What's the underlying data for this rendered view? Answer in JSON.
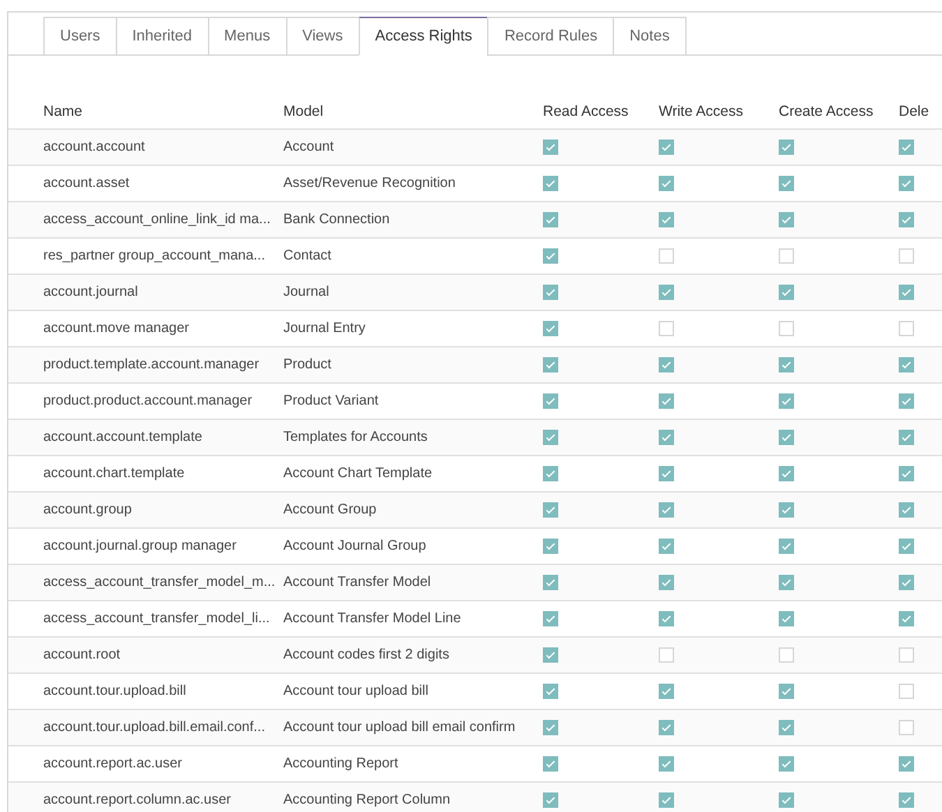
{
  "tabs": [
    {
      "label": "Users",
      "selected": false
    },
    {
      "label": "Inherited",
      "selected": false
    },
    {
      "label": "Menus",
      "selected": false
    },
    {
      "label": "Views",
      "selected": false
    },
    {
      "label": "Access Rights",
      "selected": true
    },
    {
      "label": "Record Rules",
      "selected": false
    },
    {
      "label": "Notes",
      "selected": false
    }
  ],
  "table": {
    "columns": [
      "Name",
      "Model",
      "Read Access",
      "Write Access",
      "Create Access",
      "Dele"
    ],
    "rows": [
      {
        "name": "account.account",
        "model": "Account",
        "read": true,
        "write": true,
        "create": true,
        "delete": true
      },
      {
        "name": "account.asset",
        "model": "Asset/Revenue Recognition",
        "read": true,
        "write": true,
        "create": true,
        "delete": true
      },
      {
        "name": "access_account_online_link_id ma...",
        "model": "Bank Connection",
        "read": true,
        "write": true,
        "create": true,
        "delete": true
      },
      {
        "name": "res_partner group_account_mana...",
        "model": "Contact",
        "read": true,
        "write": false,
        "create": false,
        "delete": false
      },
      {
        "name": "account.journal",
        "model": "Journal",
        "read": true,
        "write": true,
        "create": true,
        "delete": true
      },
      {
        "name": "account.move manager",
        "model": "Journal Entry",
        "read": true,
        "write": false,
        "create": false,
        "delete": false
      },
      {
        "name": "product.template.account.manager",
        "model": "Product",
        "read": true,
        "write": true,
        "create": true,
        "delete": true
      },
      {
        "name": "product.product.account.manager",
        "model": "Product Variant",
        "read": true,
        "write": true,
        "create": true,
        "delete": true
      },
      {
        "name": "account.account.template",
        "model": "Templates for Accounts",
        "read": true,
        "write": true,
        "create": true,
        "delete": true
      },
      {
        "name": "account.chart.template",
        "model": "Account Chart Template",
        "read": true,
        "write": true,
        "create": true,
        "delete": true
      },
      {
        "name": "account.group",
        "model": "Account Group",
        "read": true,
        "write": true,
        "create": true,
        "delete": true
      },
      {
        "name": "account.journal.group manager",
        "model": "Account Journal Group",
        "read": true,
        "write": true,
        "create": true,
        "delete": true
      },
      {
        "name": "access_account_transfer_model_m...",
        "model": "Account Transfer Model",
        "read": true,
        "write": true,
        "create": true,
        "delete": true
      },
      {
        "name": "access_account_transfer_model_li...",
        "model": "Account Transfer Model Line",
        "read": true,
        "write": true,
        "create": true,
        "delete": true
      },
      {
        "name": "account.root",
        "model": "Account codes first 2 digits",
        "read": true,
        "write": false,
        "create": false,
        "delete": false
      },
      {
        "name": "account.tour.upload.bill",
        "model": "Account tour upload bill",
        "read": true,
        "write": true,
        "create": true,
        "delete": false
      },
      {
        "name": "account.tour.upload.bill.email.conf...",
        "model": "Account tour upload bill email confirm",
        "read": true,
        "write": true,
        "create": true,
        "delete": false
      },
      {
        "name": "account.report.ac.user",
        "model": "Accounting Report",
        "read": true,
        "write": true,
        "create": true,
        "delete": true
      },
      {
        "name": "account.report.column.ac.user",
        "model": "Accounting Report Column",
        "read": true,
        "write": true,
        "create": true,
        "delete": true
      }
    ]
  }
}
